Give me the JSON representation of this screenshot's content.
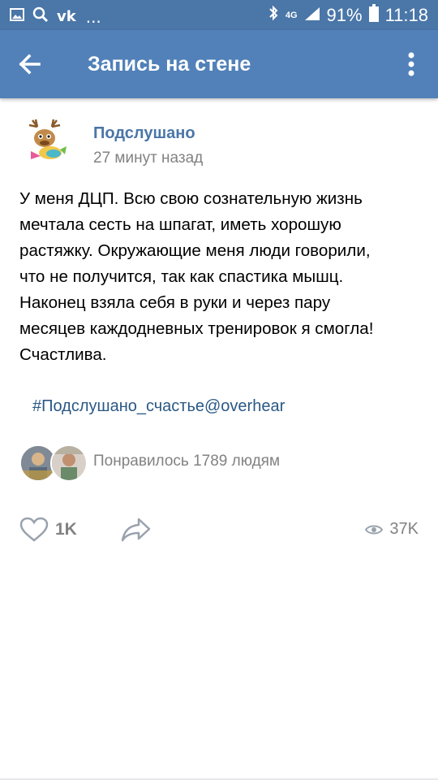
{
  "status_bar": {
    "left_icons": [
      "gallery-icon",
      "search-icon"
    ],
    "vk_label": "vk",
    "more_label": "...",
    "network": "4G",
    "battery": "91%",
    "time": "11:18"
  },
  "app_bar": {
    "title": "Запись на стене"
  },
  "post": {
    "author": "Подслушано",
    "time": "27 минут назад",
    "text_lines": [
      "У меня ДЦП. Всю свою сознательную жизнь",
      "мечтала сесть на шпагат, иметь хорошую",
      "растяжку. Окружающие меня люди говорили,",
      "что не получится, так как спастика мышц.",
      "Наконец взяла себя в руки и через пару",
      "месяцев каждодневных тренировок я смогла!",
      "Счастлива."
    ],
    "hashtag": "#Подслушано_счастье@overhear",
    "liked_by": "Понравилось 1789 людям"
  },
  "actions": {
    "likes": "1K",
    "views": "37K"
  },
  "colors": {
    "status_bar": "#4a76a8",
    "app_bar": "#5181b8",
    "link": "#2a5885",
    "muted": "#828282"
  }
}
